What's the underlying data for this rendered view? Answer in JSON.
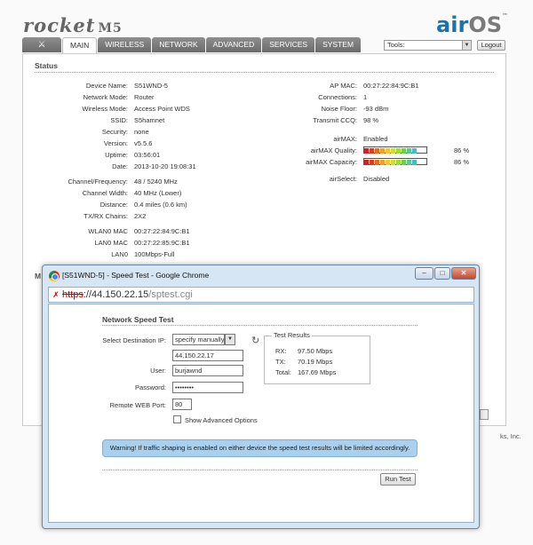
{
  "brand": {
    "name": "rocket",
    "model": "M5",
    "os_air": "air",
    "os_os": "OS",
    "tm": "™"
  },
  "tabs": [
    {
      "label": "⚔",
      "icon": "antenna-icon"
    },
    {
      "label": "MAIN"
    },
    {
      "label": "WIRELESS"
    },
    {
      "label": "NETWORK"
    },
    {
      "label": "ADVANCED"
    },
    {
      "label": "SERVICES"
    },
    {
      "label": "SYSTEM"
    }
  ],
  "tools": {
    "label": "Tools:"
  },
  "logout": {
    "label": "Logout"
  },
  "status": {
    "title": "Status",
    "left": [
      {
        "k": "Device Name:",
        "v": "S51WND-5"
      },
      {
        "k": "Network Mode:",
        "v": "Router"
      },
      {
        "k": "Wireless Mode:",
        "v": "Access Point WDS"
      },
      {
        "k": "SSID:",
        "v": "S5hamnet"
      },
      {
        "k": "Security:",
        "v": "none"
      },
      {
        "k": "Version:",
        "v": "v5.5.6"
      },
      {
        "k": "Uptime:",
        "v": "03:56:01"
      },
      {
        "k": "Date:",
        "v": "2013-10-20 19:08:31"
      },
      {
        "k": "Channel/Frequency:",
        "v": "48 / 5240 MHz"
      },
      {
        "k": "Channel Width:",
        "v": "40 MHz (Lower)"
      },
      {
        "k": "Distance:",
        "v": "0.4 miles (0.6 km)"
      },
      {
        "k": "TX/RX Chains:",
        "v": "2X2"
      },
      {
        "k": "WLAN0 MAC",
        "v": "00:27:22:84:9C:B1"
      },
      {
        "k": "LAN0 MAC",
        "v": "00:27:22:85:9C:B1"
      },
      {
        "k": "LAN0",
        "v": "100Mbps-Full"
      }
    ],
    "right": [
      {
        "k": "AP MAC:",
        "v": "00:27:22:84:9C:B1"
      },
      {
        "k": "Connections:",
        "v": "1"
      },
      {
        "k": "Noise Floor:",
        "v": "-93 dBm"
      },
      {
        "k": "Transmit CCQ:",
        "v": "98 %"
      },
      {
        "k": "airMAX:",
        "v": "Enabled"
      },
      {
        "k": "airMAX Quality:",
        "v": "86 %",
        "level": 0.86
      },
      {
        "k": "airMAX Capacity:",
        "v": "86 %",
        "level": 0.86
      },
      {
        "k": "airSelect:",
        "v": "Disabled"
      }
    ]
  },
  "footer": {
    "copyright": "ks, Inc."
  },
  "hidden_section_letter": "M",
  "popup": {
    "title": "[S51WND-5] - Speed Test - Google Chrome",
    "url_scheme": "https",
    "url_host": "://44.150.22.15",
    "url_path": "/sptest.cgi",
    "controls": {
      "minimize": "–",
      "maximize": "□",
      "close": "✕"
    },
    "heading": "Network Speed Test",
    "fields": {
      "dest_label": "Select Destination IP:",
      "dest_value": "specify manually",
      "ip_value": "44.150.22.17",
      "user_label": "User:",
      "user_value": "burjawnd",
      "password_label": "Password:",
      "password_value": "••••••••",
      "port_label": "Remote WEB Port:",
      "port_value": "80",
      "advanced_label": "Show Advanced Options"
    },
    "results": {
      "legend": "Test Results",
      "rx_label": "RX:",
      "rx_value": "97.50 Mbps",
      "tx_label": "TX:",
      "tx_value": "70.19 Mbps",
      "total_label": "Total:",
      "total_value": "167.69 Mbps"
    },
    "warning": "Warning! If traffic shaping is enabled on either device the speed test results will be limited accordingly.",
    "run_button": "Run Test"
  }
}
